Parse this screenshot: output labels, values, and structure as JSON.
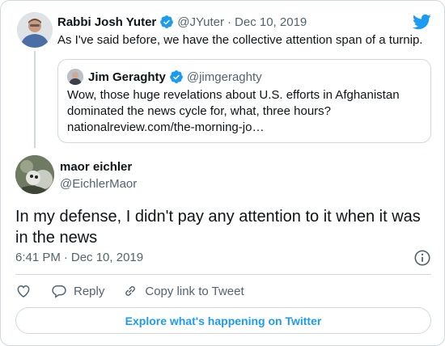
{
  "parent_tweet": {
    "author_name": "Rabbi Josh Yuter",
    "author_handle": "@JYuter",
    "separator": "·",
    "date": "Dec 10, 2019",
    "text": "As I've said before, we have the collective attention span of a turnip.",
    "verified": true
  },
  "quoted_tweet": {
    "author_name": "Jim Geraghty",
    "author_handle": "@jimgeraghty",
    "verified": true,
    "text": "Wow, those huge revelations about U.S. efforts in Afghanistan dominated the news cycle for, what, three hours?",
    "link": "nationalreview.com/the-morning-jo…"
  },
  "main_tweet": {
    "author_name": "maor eichler",
    "author_handle": "@EichlerMaor",
    "text": "In my defense, I didn't pay any attention to it when it was in the news",
    "time": "6:41 PM",
    "separator": "·",
    "date": "Dec 10, 2019"
  },
  "actions": {
    "like_icon": "heart-icon",
    "reply_label": "Reply",
    "copy_link_label": "Copy link to Tweet"
  },
  "explore_button": {
    "label": "Explore what's happening on Twitter"
  },
  "colors": {
    "accent": "#1d9bf0",
    "text_primary": "#0f1419",
    "text_secondary": "#536471",
    "border": "#cfd9de"
  }
}
